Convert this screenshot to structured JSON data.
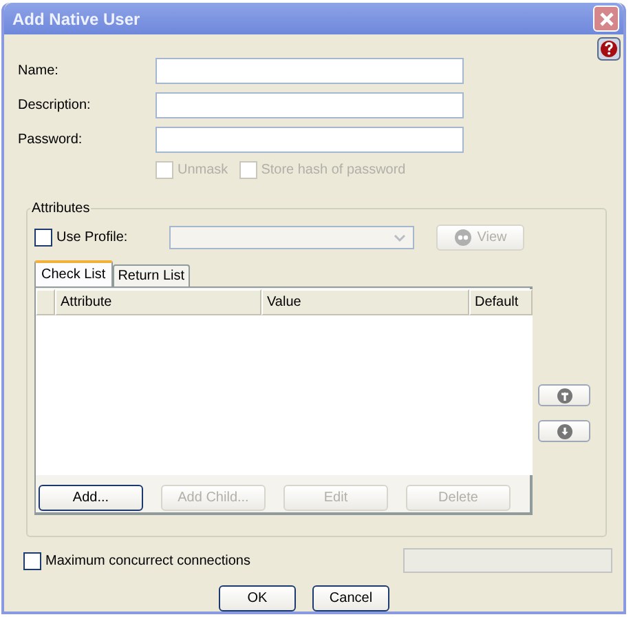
{
  "window": {
    "title": "Add Native User"
  },
  "fields": [
    {
      "label": "Name:"
    },
    {
      "label": "Description:"
    },
    {
      "label": "Password:"
    }
  ],
  "password_options": [
    {
      "label": "Unmask",
      "checked": false,
      "disabled": true
    },
    {
      "label": "Store hash of password",
      "checked": false,
      "disabled": true
    }
  ],
  "attributes": {
    "title": "Attributes",
    "use_profile": {
      "label": "Use Profile:",
      "checked": false
    },
    "view_button": {
      "label": "View",
      "disabled": true
    },
    "tabs": [
      {
        "label": "Check List",
        "selected": true
      },
      {
        "label": "Return List",
        "selected": false
      }
    ],
    "columns": [
      "Attribute",
      "Value",
      "Default"
    ],
    "buttons": [
      {
        "label": "Add...",
        "disabled": false
      },
      {
        "label": "Add Child...",
        "disabled": true
      },
      {
        "label": "Edit",
        "disabled": true
      },
      {
        "label": "Delete",
        "disabled": true
      }
    ]
  },
  "max_connections": {
    "label": "Maximum concurrect connections",
    "checked": false
  },
  "buttons": [
    "OK",
    "Cancel"
  ]
}
